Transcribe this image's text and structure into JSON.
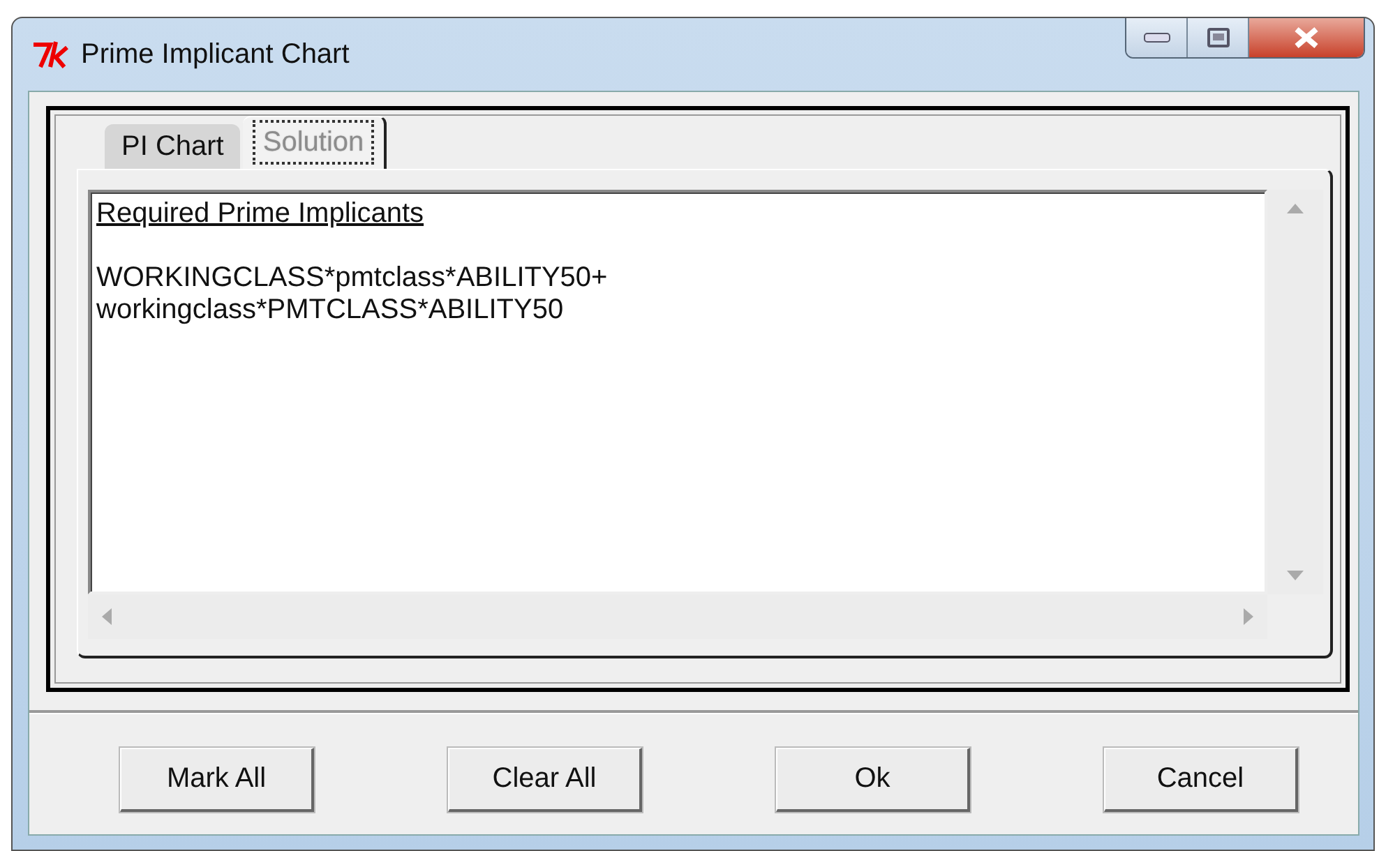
{
  "window": {
    "title": "Prime Implicant Chart"
  },
  "tabs": [
    {
      "label": "PI Chart",
      "selected": false
    },
    {
      "label": "Solution",
      "selected": true
    }
  ],
  "text_area": {
    "heading": "Required Prime Implicants",
    "lines": [
      "WORKINGCLASS*pmtclass*ABILITY50+",
      "workingclass*PMTCLASS*ABILITY50"
    ]
  },
  "buttons": [
    "Mark All",
    "Clear All",
    "Ok",
    "Cancel"
  ]
}
